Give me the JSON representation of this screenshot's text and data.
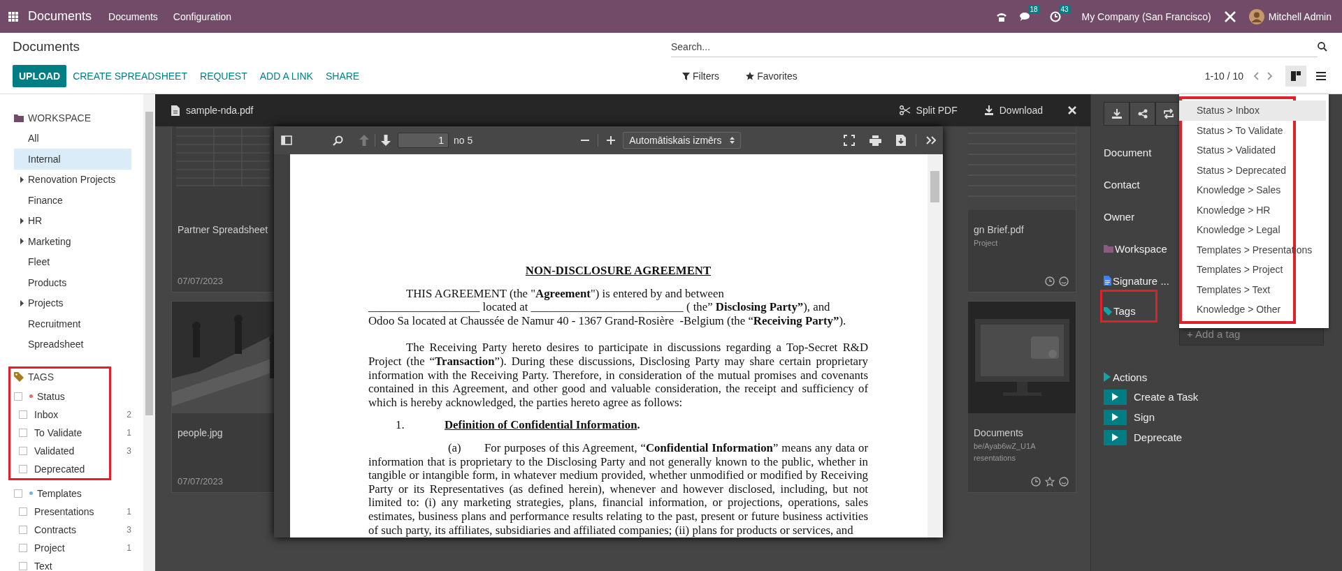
{
  "navbar": {
    "app_name": "Documents",
    "menu": [
      "Documents",
      "Configuration"
    ],
    "messages_badge": "18",
    "activities_badge": "43",
    "company": "My Company (San Francisco)",
    "user": "Mitchell Admin"
  },
  "control_panel": {
    "title": "Documents",
    "buttons": [
      {
        "label": "UPLOAD",
        "kind": "primary"
      },
      {
        "label": "CREATE SPREADSHEET",
        "kind": "link"
      },
      {
        "label": "REQUEST",
        "kind": "link"
      },
      {
        "label": "ADD A LINK",
        "kind": "link"
      },
      {
        "label": "SHARE",
        "kind": "link"
      }
    ],
    "search": {
      "placeholder": "Search..."
    },
    "filters": "Filters",
    "favorites": "Favorites",
    "pager": "1-10 / 10",
    "views": [
      {
        "kind": "kanban",
        "selected": true
      },
      {
        "kind": "list",
        "selected": false
      }
    ]
  },
  "sidebar": {
    "workspace_heading": "WORKSPACE",
    "workspaces": [
      {
        "label": "All",
        "selected": false,
        "has_children": false
      },
      {
        "label": "Internal",
        "selected": true,
        "has_children": false
      },
      {
        "label": "Renovation Projects",
        "selected": false,
        "has_children": true
      },
      {
        "label": "Finance",
        "selected": false,
        "has_children": false
      },
      {
        "label": "HR",
        "selected": false,
        "has_children": true
      },
      {
        "label": "Marketing",
        "selected": false,
        "has_children": true
      },
      {
        "label": "Fleet",
        "selected": false,
        "has_children": false
      },
      {
        "label": "Products",
        "selected": false,
        "has_children": false
      },
      {
        "label": "Projects",
        "selected": false,
        "has_children": true
      },
      {
        "label": "Recruitment",
        "selected": false,
        "has_children": false
      },
      {
        "label": "Spreadsheet",
        "selected": false,
        "has_children": false
      }
    ],
    "tags_heading": "TAGS",
    "tag_groups": [
      {
        "name": "Status",
        "color": "#e06c6c",
        "checked": false,
        "highlighted": true,
        "tags": [
          {
            "label": "Inbox",
            "count": "2",
            "checked": false
          },
          {
            "label": "To Validate",
            "count": "1",
            "checked": false
          },
          {
            "label": "Validated",
            "count": "3",
            "checked": false
          },
          {
            "label": "Deprecated",
            "checked": false
          }
        ]
      },
      {
        "name": "Templates",
        "color": "#6cb7e0",
        "checked": false,
        "highlighted": false,
        "tags": [
          {
            "label": "Presentations",
            "count": "1",
            "checked": false
          },
          {
            "label": "Contracts",
            "count": "3",
            "checked": false
          },
          {
            "label": "Project",
            "count": "1",
            "checked": false
          },
          {
            "label": "Text",
            "checked": false
          }
        ]
      }
    ]
  },
  "kanban": {
    "left_cards": [
      {
        "title": "Partner Spreadsheet",
        "date": "07/07/2023",
        "kind": "spreadsheet"
      },
      {
        "title": "people.jpg",
        "date": "07/07/2023"
      }
    ],
    "right_cards": [
      {
        "title": "gn Brief.pdf",
        "lines": [
          "Project"
        ],
        "kind": "document",
        "star": false
      },
      {
        "title": "Documents",
        "lines": [
          "be/Ayab6wZ_U1A",
          "resentations"
        ],
        "kind": "video",
        "star": true
      }
    ]
  },
  "preview": {
    "file_name": "sample-nda.pdf",
    "actions": [
      {
        "label": "Split PDF",
        "kind": "split"
      },
      {
        "label": "Download",
        "kind": "download"
      }
    ],
    "toolbar": {
      "page": "1",
      "page_count": "no 5",
      "zoom": "Automātiskais izmērs"
    },
    "document": {
      "title": "NON-DISCLOSURE AGREEMENT",
      "blocks": [
        {
          "kind": "segments",
          "segments": [
            {
              "text": "THIS AGREEMENT (the \"",
              "bold": false
            },
            {
              "text": "Agreement",
              "bold": true
            },
            {
              "text": "\") is entered by and between\n___________________ located at __________________________ ( the” ",
              "bold": false
            },
            {
              "text": "Disclosing Party”",
              "bold": true
            },
            {
              "text": "), and\nOdoo Sa located at Chaussée de Namur 40 - 1367 Grand-Rosière  -Belgium (the “",
              "bold": false
            },
            {
              "text": "Receiving Party”",
              "bold": true
            },
            {
              "text": ").",
              "bold": false
            }
          ]
        },
        {
          "kind": "paragraph",
          "text": "The Receiving Party hereto desires to participate in discussions regarding a Top-Secret R&D Project (the “**Transaction**”).  During these discussions, Disclosing Party may share certain proprietary information with the Receiving Party.  Therefore, in consideration of the mutual promises and covenants contained in this Agreement, and other good and valuable consideration, the receipt and sufficiency of which is hereby acknowledged, the parties hereto agree as follows:"
        },
        {
          "kind": "heading",
          "number": "1.",
          "title": "Definition of Confidential Information",
          "end": "."
        },
        {
          "kind": "item",
          "marker": "(a)",
          "text": "For purposes of this Agreement, “**Confidential Information**” means any data or information that is proprietary to the Disclosing Party and not generally known to the public, whether in tangible or intangible form, in whatever medium provided, whether unmodified or modified by Receiving Party or its Representatives (as defined herein), whenever and however disclosed, including, but not limited to: (i) any marketing strategies, plans, financial information, or projections, operations, sales estimates, business plans and performance results relating to the past, present or future business activities of such party, its affiliates, subsidiaries and affiliated companies; (ii) plans for products or services, and"
        }
      ]
    }
  },
  "details": {
    "fields": [
      {
        "label": "Document",
        "kind": "plain",
        "highlighted": false
      },
      {
        "label": "Contact",
        "kind": "plain",
        "highlighted": false
      },
      {
        "label": "Owner",
        "kind": "plain",
        "highlighted": false
      },
      {
        "label": "Workspace",
        "kind": "workspace",
        "highlighted": false
      },
      {
        "label": "Signature ...",
        "kind": "document",
        "highlighted": false
      },
      {
        "label": "Tags",
        "kind": "tags",
        "placeholder": "+ Add a tag",
        "highlighted": true
      }
    ],
    "actions_heading": "Actions",
    "actions": [
      "Create a Task",
      "Sign",
      "Deprecate"
    ],
    "tag_dropdown": {
      "highlighted": true,
      "options": [
        {
          "label": "Status > Inbox",
          "selected": true
        },
        {
          "label": "Status > To Validate",
          "selected": false
        },
        {
          "label": "Status > Validated",
          "selected": false
        },
        {
          "label": "Status > Deprecated",
          "selected": false
        },
        {
          "label": "Knowledge > Sales",
          "selected": false
        },
        {
          "label": "Knowledge > HR",
          "selected": false
        },
        {
          "label": "Knowledge > Legal",
          "selected": false
        },
        {
          "label": "Templates > Presentations",
          "selected": false
        },
        {
          "label": "Templates > Project",
          "selected": false
        },
        {
          "label": "Templates > Text",
          "selected": false
        },
        {
          "label": "Knowledge > Other",
          "selected": false
        }
      ]
    }
  }
}
